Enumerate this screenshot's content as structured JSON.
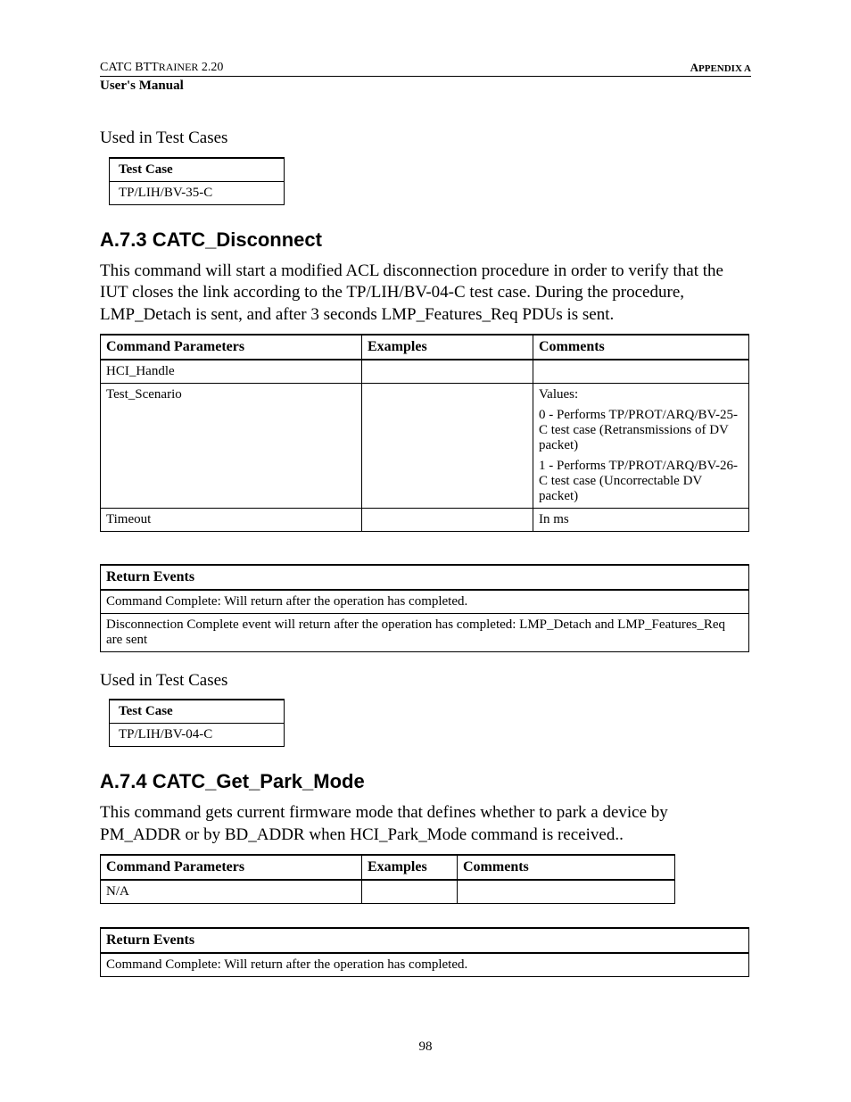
{
  "header": {
    "left_prefix": "CATC BTT",
    "left_suffix": "RAINER",
    "version": " 2.20",
    "right_prefix": "A",
    "right_suffix": "PPENDIX A",
    "manual": "User's Manual"
  },
  "section1": {
    "intro": "Used in Test Cases",
    "table_header": "Test Case",
    "table_value": "TP/LIH/BV-35-C"
  },
  "section2": {
    "heading": "A.7.3  CATC_Disconnect",
    "para": "This command will start a modified ACL disconnection procedure in order to verify that the IUT closes the link according to the TP/LIH/BV-04-C test case. During the procedure, LMP_Detach is sent, and after 3 seconds LMP_Features_Req PDUs is sent.",
    "params": {
      "h1": "Command Parameters",
      "h2": "Examples",
      "h3": "Comments",
      "r1c1": "HCI_Handle",
      "r2c1": "Test_Scenario",
      "r2c3a": "Values:",
      "r2c3b": "0 - Performs TP/PROT/ARQ/BV-25-C test case (Retransmissions of DV packet)",
      "r2c3c": "1 - Performs TP/PROT/ARQ/BV-26-C test case (Uncorrectable DV packet)",
      "r3c1": "Timeout",
      "r3c3": "In ms"
    },
    "events": {
      "header": "Return Events",
      "r1": "Command Complete: Will return after the operation has completed.",
      "r2": "Disconnection Complete event will return after the operation has completed: LMP_Detach and LMP_Features_Req are sent"
    },
    "used_intro": "Used in Test Cases",
    "used_header": "Test Case",
    "used_value": "TP/LIH/BV-04-C"
  },
  "section3": {
    "heading": "A.7.4  CATC_Get_Park_Mode",
    "para": "This command gets current firmware mode that defines whether to park a device by PM_ADDR or by BD_ADDR when HCI_Park_Mode command is received..",
    "params": {
      "h1": "Command Parameters",
      "h2": "Examples",
      "h3": "Comments",
      "r1c1": "N/A"
    },
    "events": {
      "header": "Return Events",
      "r1": "Command Complete: Will return after the operation has completed."
    }
  },
  "page_number": "98"
}
